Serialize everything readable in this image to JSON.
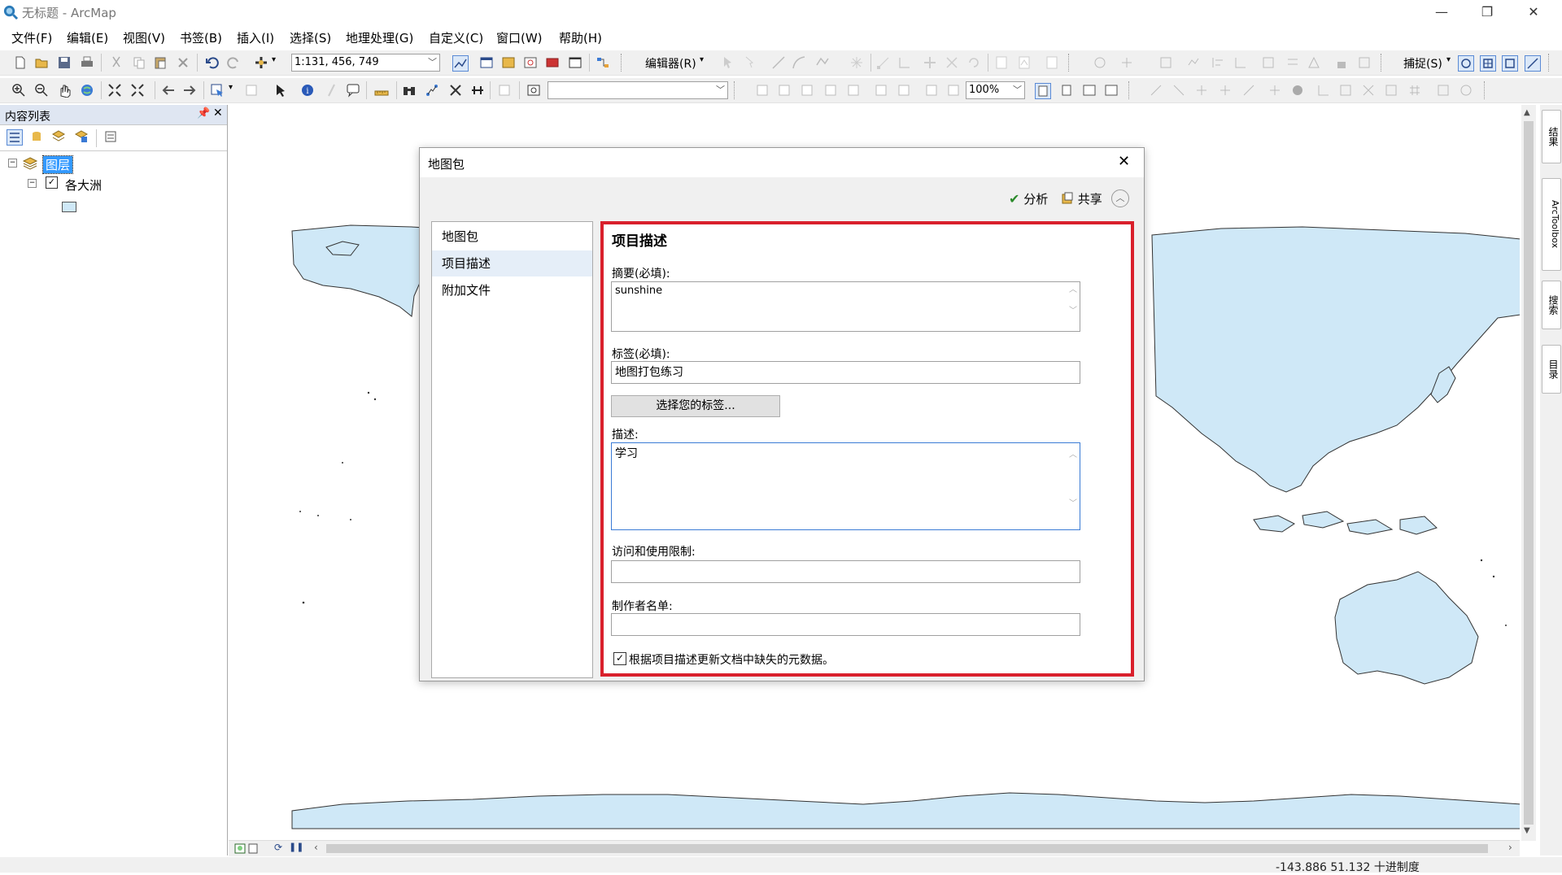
{
  "window": {
    "title": "无标题 - ArcMap"
  },
  "menu": [
    "文件(F)",
    "编辑(E)",
    "视图(V)",
    "书签(B)",
    "插入(I)",
    "选择(S)",
    "地理处理(G)",
    "自定义(C)",
    "窗口(W)",
    "帮助(H)"
  ],
  "toolbar": {
    "scale": "1:131, 456, 749",
    "editor": "编辑器(R)",
    "snapping": "捕捉(S)",
    "zoom": "100%"
  },
  "toc": {
    "title": "内容列表",
    "layers_label": "图层",
    "layer_name": "各大洲"
  },
  "right_tabs": [
    "结果",
    "ArcToolbox",
    "搜索",
    "目录"
  ],
  "dialog": {
    "title": "地图包",
    "analyze_label": "分析",
    "share_label": "共享",
    "nav": [
      "地图包",
      "项目描述",
      "附加文件"
    ],
    "section_title": "项目描述",
    "summary_label": "摘要(必填):",
    "summary_value": "sunshine",
    "tags_label": "标签(必填):",
    "tags_value": "地图打包练习",
    "choose_tags_button": "选择您的标签...",
    "description_label": "描述:",
    "description_value": "学习",
    "access_label": "访问和使用限制:",
    "access_value": "",
    "credits_label": "制作者名单:",
    "credits_value": "",
    "update_metadata_label": "根据项目描述更新文档中缺失的元数据。",
    "update_metadata_checked": true
  },
  "status": {
    "coordinates": "-143.886  51.132 十进制度"
  },
  "colors": {
    "land": "#cfe8f7",
    "highlight_border": "#d9202c",
    "selected_layer": "#3399ff"
  }
}
